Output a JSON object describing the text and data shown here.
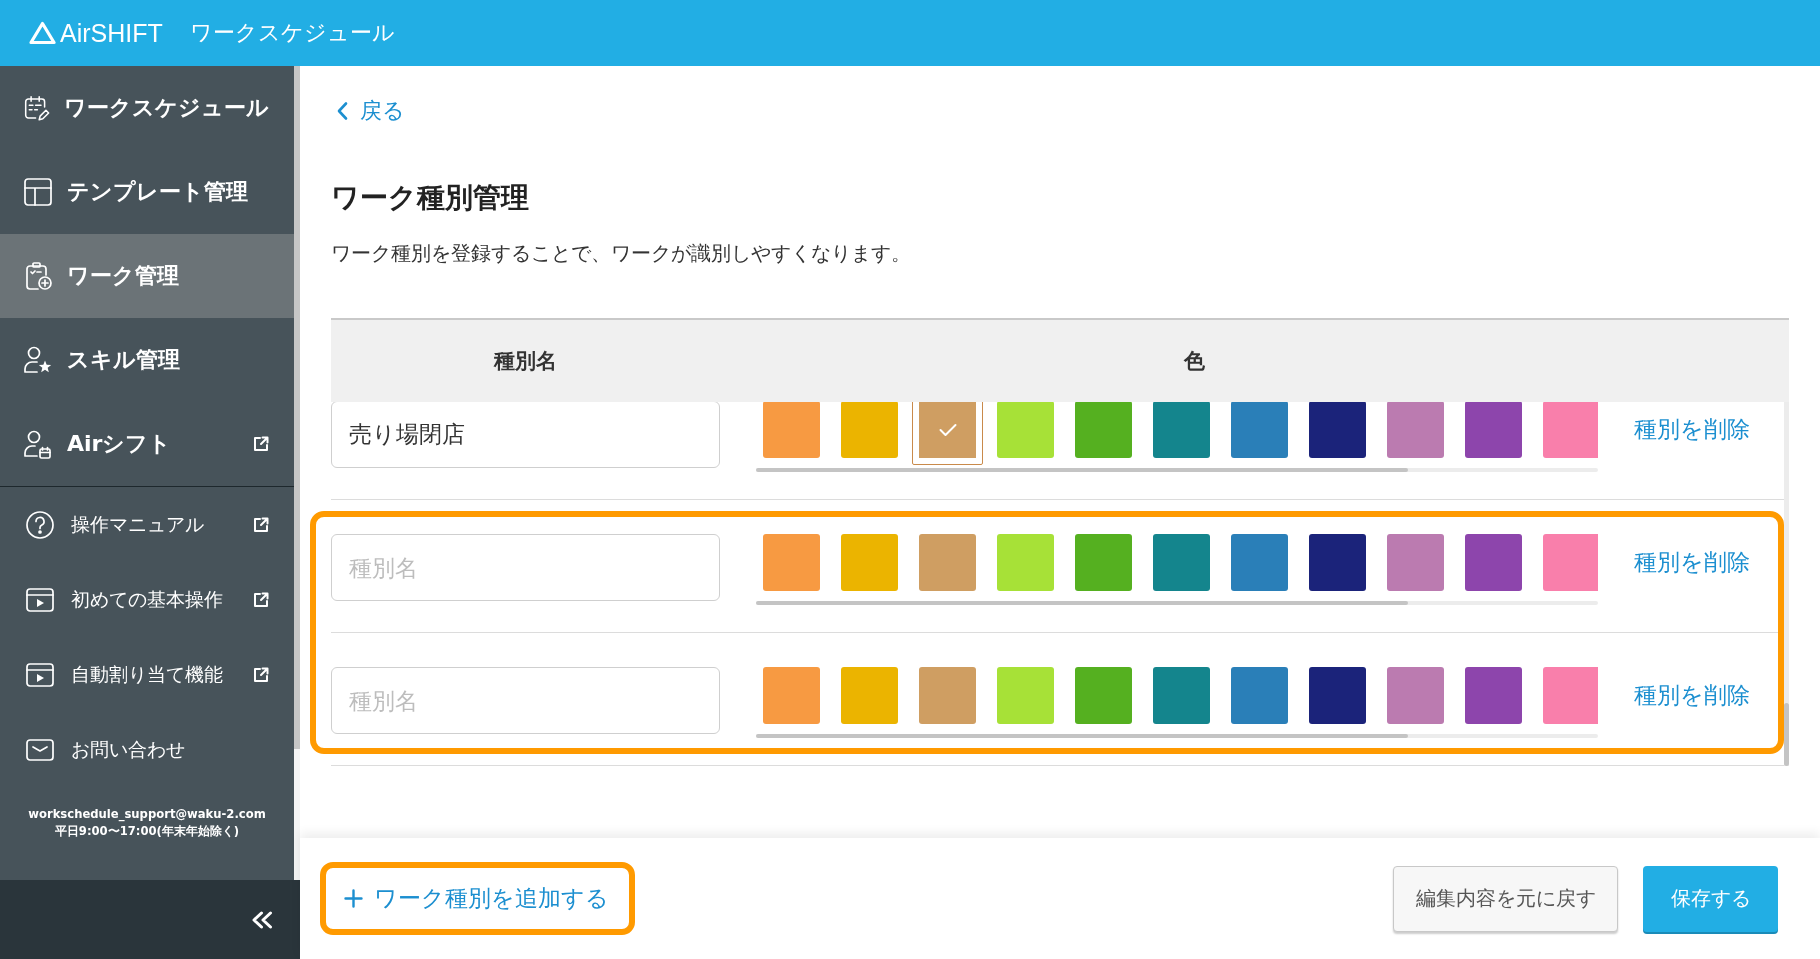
{
  "header": {
    "logo": "AirSHIFT",
    "title": "ワークスケジュール"
  },
  "sidebar": {
    "nav": [
      {
        "label": "ワークスケジュール",
        "selected": false,
        "external": false
      },
      {
        "label": "テンプレート管理",
        "selected": false,
        "external": false
      },
      {
        "label": "ワーク管理",
        "selected": true,
        "external": false
      },
      {
        "label": "スキル管理",
        "selected": false,
        "external": false
      },
      {
        "label": "Airシフト",
        "selected": false,
        "external": true
      }
    ],
    "help": [
      {
        "label": "操作マニュアル",
        "external": true
      },
      {
        "label": "初めての基本操作",
        "external": true
      },
      {
        "label": "自動割り当て機能",
        "external": true
      },
      {
        "label": "お問い合わせ",
        "external": false
      }
    ],
    "support": {
      "email": "workschedule_support@waku-2.com",
      "hours": "平日9:00〜17:00(年末年始除く)"
    }
  },
  "back_link": "戻る",
  "page": {
    "title": "ワーク種別管理",
    "description": "ワーク種別を登録することで、ワークが識別しやすくなります。"
  },
  "table": {
    "columns": [
      "種別名",
      "色"
    ],
    "rows": [
      {
        "name": {
          "value": "売り場閉店"
        },
        "swatches": [
          {
            "color": "#f79a42",
            "selected": false
          },
          {
            "color": "#ebb400",
            "selected": false
          },
          {
            "color": "#cf9e62",
            "selected": true
          },
          {
            "color": "#a7e137",
            "selected": false
          },
          {
            "color": "#55b020",
            "selected": false
          },
          {
            "color": "#14858d",
            "selected": false
          },
          {
            "color": "#2a7fb8",
            "selected": false
          },
          {
            "color": "#1b237a",
            "selected": false
          },
          {
            "color": "#bb7bb0",
            "selected": false
          },
          {
            "color": "#8d45ac",
            "selected": false
          },
          {
            "color": "#f97fab",
            "selected": false
          }
        ],
        "delete": "種別を削除",
        "highlighted": false
      },
      {
        "name": {
          "placeholder": "種別名"
        },
        "swatches": [
          {
            "color": "#f79a42",
            "selected": false
          },
          {
            "color": "#ebb400",
            "selected": false
          },
          {
            "color": "#cf9e62",
            "selected": false
          },
          {
            "color": "#a7e137",
            "selected": false
          },
          {
            "color": "#55b020",
            "selected": false
          },
          {
            "color": "#14858d",
            "selected": false
          },
          {
            "color": "#2a7fb8",
            "selected": false
          },
          {
            "color": "#1b237a",
            "selected": false
          },
          {
            "color": "#bb7bb0",
            "selected": false
          },
          {
            "color": "#8d45ac",
            "selected": false
          },
          {
            "color": "#f97fab",
            "selected": false
          }
        ],
        "delete": "種別を削除",
        "highlighted": true
      },
      {
        "name": {
          "placeholder": "種別名"
        },
        "swatches": [
          {
            "color": "#f79a42",
            "selected": false
          },
          {
            "color": "#ebb400",
            "selected": false
          },
          {
            "color": "#cf9e62",
            "selected": false
          },
          {
            "color": "#a7e137",
            "selected": false
          },
          {
            "color": "#55b020",
            "selected": false
          },
          {
            "color": "#14858d",
            "selected": false
          },
          {
            "color": "#2a7fb8",
            "selected": false
          },
          {
            "color": "#1b237a",
            "selected": false
          },
          {
            "color": "#bb7bb0",
            "selected": false
          },
          {
            "color": "#8d45ac",
            "selected": false
          },
          {
            "color": "#f97fab",
            "selected": false
          }
        ],
        "delete": "種別を削除",
        "highlighted": true
      }
    ]
  },
  "footer": {
    "add_button": {
      "label": "ワーク種別を追加する",
      "highlighted": true
    },
    "buttons": [
      {
        "label": "編集内容を元に戻す",
        "kind": "secondary"
      },
      {
        "label": "保存する",
        "kind": "primary"
      }
    ]
  }
}
